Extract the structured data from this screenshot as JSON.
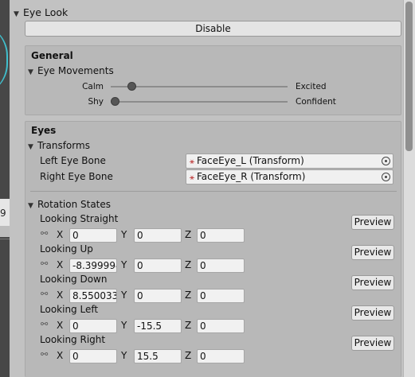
{
  "scene": {
    "number_fragment": "9"
  },
  "eye_look": {
    "title": "Eye Look",
    "disable_label": "Disable"
  },
  "general": {
    "title": "General",
    "eye_movements_label": "Eye Movements",
    "sliders": [
      {
        "left_label": "Calm",
        "right_label": "Excited",
        "value": 0.1
      },
      {
        "left_label": "Shy",
        "right_label": "Confident",
        "value": 0.0
      }
    ]
  },
  "eyes": {
    "title": "Eyes",
    "transforms_label": "Transforms",
    "left_bone_label": "Left Eye Bone",
    "left_bone_value": "FaceEye_L (Transform)",
    "right_bone_label": "Right Eye Bone",
    "right_bone_value": "FaceEye_R (Transform)",
    "rotation_states_label": "Rotation States",
    "preview_label": "Preview",
    "axis_x": "X",
    "axis_y": "Y",
    "axis_z": "Z",
    "states": [
      {
        "name": "Looking Straight",
        "x": "0",
        "y": "0",
        "z": "0"
      },
      {
        "name": "Looking Up",
        "x": "-8.399994",
        "y": "0",
        "z": "0"
      },
      {
        "name": "Looking Down",
        "x": "8.550033",
        "y": "0",
        "z": "0"
      },
      {
        "name": "Looking Left",
        "x": "0",
        "y": "-15.5",
        "z": "0"
      },
      {
        "name": "Looking Right",
        "x": "0",
        "y": "15.5",
        "z": "0"
      }
    ]
  },
  "colors": {
    "panel": "#c2c2c2",
    "box": "#b8b8b8",
    "field": "#f1f1f1",
    "scene_dark": "#474747",
    "accent_cyan": "#3fd6e6"
  }
}
